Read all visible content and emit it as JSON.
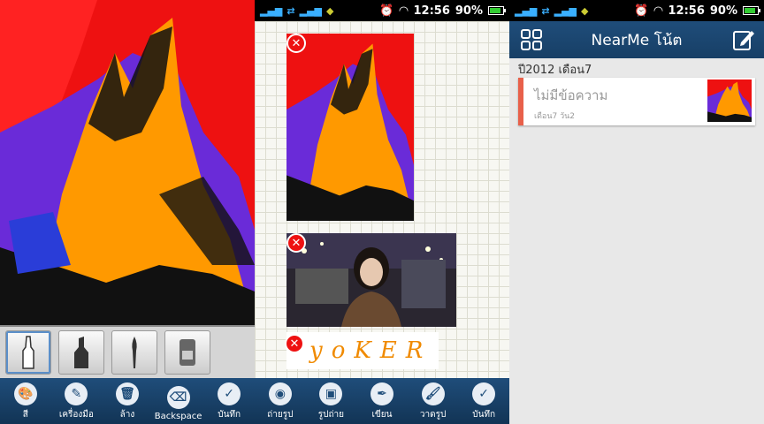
{
  "status": {
    "time": "12:56",
    "battery": "90%",
    "battery_level": 0.9
  },
  "drawing_tray": {
    "brushes": [
      "marker-icon",
      "chisel-marker-icon",
      "paintbrush-icon",
      "eraser-icon"
    ]
  },
  "toolbar_left": [
    {
      "label": "สี",
      "icon": "palette-icon"
    },
    {
      "label": "เครื่องมือ",
      "icon": "brush-tool-icon"
    },
    {
      "label": "ล้าง",
      "icon": "trash-icon"
    },
    {
      "label": "Backspace",
      "icon": "backspace-icon"
    },
    {
      "label": "บันทึก",
      "icon": "check-icon"
    }
  ],
  "toolbar_right": [
    {
      "label": "ถ่ายรูป",
      "icon": "camera-icon"
    },
    {
      "label": "รูปถ่าย",
      "icon": "photo-icon"
    },
    {
      "label": "เขียน",
      "icon": "pen-icon"
    },
    {
      "label": "วาดรูป",
      "icon": "paintbrush-icon"
    },
    {
      "label": "บันทึก",
      "icon": "check-icon"
    }
  ],
  "handwriting": "yoKER",
  "notes_app": {
    "title": "NearMe โน้ต",
    "section": "ปี2012 เดือน7",
    "note": {
      "title": "ไม่มีข้อความ",
      "subtitle": "เดือน7 วัน2"
    }
  },
  "colors": {
    "accent": "#1f4d7a",
    "card_stripe": "#e8604a",
    "delete": "#e11111"
  }
}
